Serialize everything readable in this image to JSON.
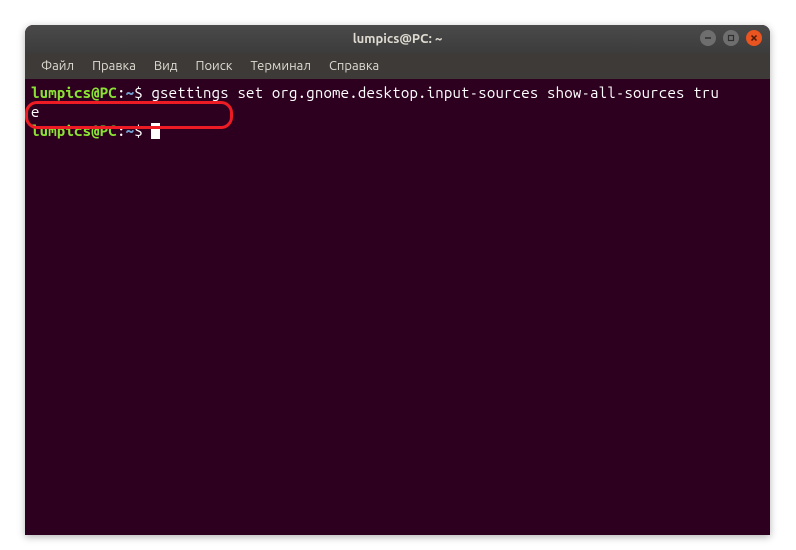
{
  "window": {
    "title": "lumpics@PC: ~"
  },
  "menubar": {
    "items": [
      {
        "label": "Файл"
      },
      {
        "label": "Правка"
      },
      {
        "label": "Вид"
      },
      {
        "label": "Поиск"
      },
      {
        "label": "Терминал"
      },
      {
        "label": "Справка"
      }
    ]
  },
  "terminal": {
    "line1": {
      "user": "lumpics@PC",
      "colon": ":",
      "path": "~",
      "dollar": "$",
      "command": " gsettings set org.gnome.desktop.input-sources show-all-sources tru"
    },
    "line2": {
      "text": "e"
    },
    "line3": {
      "user": "lumpics@PC",
      "colon": ":",
      "path": "~",
      "dollar": "$",
      "command": " "
    }
  },
  "window_controls": {
    "minimize": "−",
    "maximize": "◻",
    "close": "×"
  }
}
